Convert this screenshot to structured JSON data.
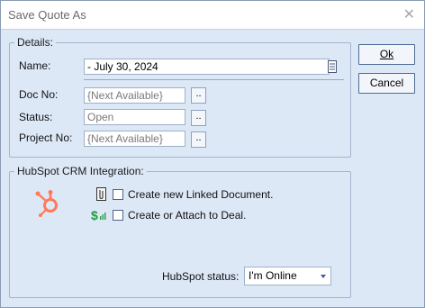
{
  "window": {
    "title": "Save Quote As",
    "close_glyph": "✕"
  },
  "details": {
    "group_label": "Details:",
    "name_label": "Name:",
    "name_value": "- July 30, 2024",
    "doc_no_label": "Doc No:",
    "doc_no_value": "{Next Available}",
    "status_label": "Status:",
    "status_value": "Open",
    "project_no_label": "Project No:",
    "project_no_value": "{Next Available}",
    "browse_label": ".."
  },
  "hubspot": {
    "group_label": "HubSpot CRM Integration:",
    "create_linked_label": "Create new Linked Document.",
    "attach_deal_label": "Create or Attach to Deal.",
    "status_label": "HubSpot status:",
    "status_value": "I'm Online"
  },
  "buttons": {
    "ok_label": "Ok",
    "cancel_label": "Cancel"
  },
  "colors": {
    "hubspot_orange": "#ff7a59",
    "deal_green": "#1e9c3c"
  },
  "icons": {
    "hubspot_logo": "hubspot-logo",
    "linked_document": "paperclip-document-icon",
    "deal": "dollar-icon",
    "name_picker": "list-icon"
  }
}
